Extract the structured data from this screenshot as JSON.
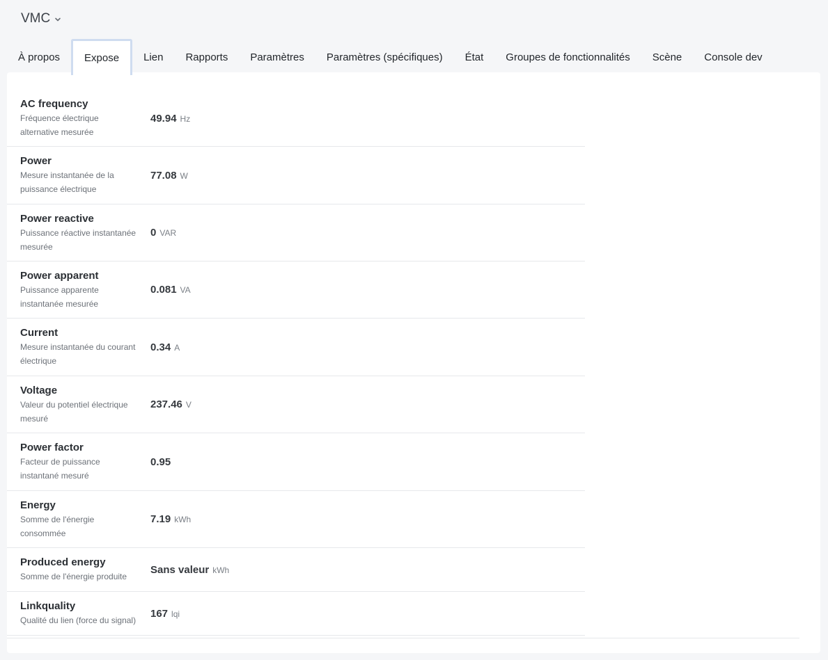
{
  "device": {
    "title": "VMC"
  },
  "tabs": [
    {
      "label": "À propos"
    },
    {
      "label": "Expose"
    },
    {
      "label": "Lien"
    },
    {
      "label": "Rapports"
    },
    {
      "label": "Paramètres"
    },
    {
      "label": "Paramètres (spécifiques)"
    },
    {
      "label": "État"
    },
    {
      "label": "Groupes de fonctionnalités"
    },
    {
      "label": "Scène"
    },
    {
      "label": "Console dev"
    }
  ],
  "active_tab": "Expose",
  "expose": [
    {
      "name": "AC frequency",
      "desc1": "Fréquence électrique",
      "desc2": "alternative mesurée",
      "value": "49.94",
      "unit": "Hz"
    },
    {
      "name": "Power",
      "desc1": "Mesure instantanée de la",
      "desc2": "puissance électrique",
      "value": "77.08",
      "unit": "W"
    },
    {
      "name": "Power reactive",
      "desc1": "Puissance réactive instantanée",
      "desc2": "mesurée",
      "value": "0",
      "unit": "VAR"
    },
    {
      "name": "Power apparent",
      "desc1": "Puissance apparente",
      "desc2": "instantanée mesurée",
      "value": "0.081",
      "unit": "VA"
    },
    {
      "name": "Current",
      "desc1": "Mesure instantanée du courant",
      "desc2": "électrique",
      "value": "0.34",
      "unit": "A"
    },
    {
      "name": "Voltage",
      "desc1": "Valeur du potentiel électrique",
      "desc2": "mesuré",
      "value": "237.46",
      "unit": "V"
    },
    {
      "name": "Power factor",
      "desc1": "Facteur de puissance",
      "desc2": "instantané mesuré",
      "value": "0.95",
      "unit": ""
    },
    {
      "name": "Energy",
      "desc1": "Somme de l'énergie",
      "desc2": "consommée",
      "value": "7.19",
      "unit": "kWh"
    },
    {
      "name": "Produced energy",
      "desc1": "Somme de l'énergie produite",
      "desc2": "",
      "value": "Sans valeur",
      "unit": "kWh"
    },
    {
      "name": "Linkquality",
      "desc1": "Qualité du lien (force du signal)",
      "desc2": "",
      "value": "167",
      "unit": "lqi"
    }
  ]
}
